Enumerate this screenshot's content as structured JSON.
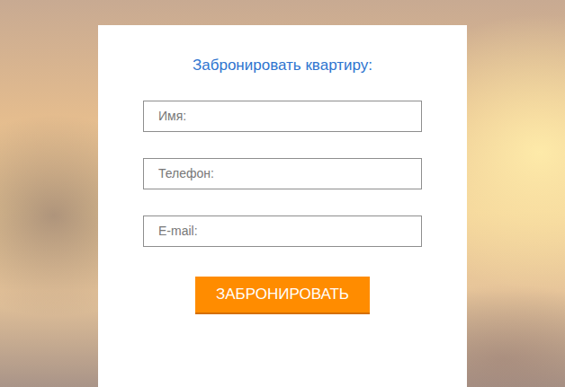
{
  "form": {
    "title": "Забронировать квартиру:",
    "fields": [
      {
        "placeholder": "Имя:"
      },
      {
        "placeholder": "Телефон:"
      },
      {
        "placeholder": "E-mail:"
      }
    ],
    "button": "ЗАБРОНИРОВАТЬ"
  }
}
